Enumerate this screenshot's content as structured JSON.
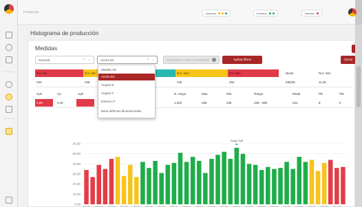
{
  "app": {
    "name": "Producción"
  },
  "rail_icons": [
    "logo-icon",
    "home-icon",
    "location-icon",
    "document-icon",
    "settings-icon",
    "gauge-icon",
    "stats-icon",
    "tag-icon",
    "menu-icon"
  ],
  "topbar": {
    "pills": [
      {
        "label": "Alarmas"
      },
      {
        "label": "Eventos"
      },
      {
        "label": "Nombre"
      }
    ]
  },
  "page": {
    "title": "Histograma de producción"
  },
  "card": {
    "title": "Medidas"
  },
  "filters": {
    "general_label": "General",
    "measure_label": "Ancho EC",
    "date_label": "22/04/2024 12:00 a 22/04/2024",
    "apply_label": "Aplicar filtros",
    "close_label": "Cerrar"
  },
  "dropdown": {
    "items": [
      {
        "label": "Medida AB",
        "selected": false
      },
      {
        "label": "Ancho EC",
        "selected": true
      },
      {
        "label": "Ángulo B",
        "selected": false
      },
      {
        "label": "Ángulo E",
        "selected": false
      },
      {
        "label": "Extremo F",
        "selected": false
      },
      {
        "label": "Baso defectos dimensionales",
        "selected": false
      }
    ]
  },
  "limits_table": {
    "headers": [
      {
        "label": "Tol. Min",
        "style": "red"
      },
      {
        "label": "Nor. Min",
        "style": "yellow"
      },
      {
        "label": "",
        "style": "teal"
      },
      {
        "label": "Nor. Max",
        "style": "yellow"
      },
      {
        "label": "Tol. Max",
        "style": "red"
      },
      {
        "label": "Nivan",
        "style": "plain"
      },
      {
        "label": "Nor. Nos",
        "style": "plain"
      }
    ],
    "values": [
      "230",
      "235",
      "245",
      "250",
      "235/25",
      "11,45"
    ]
  },
  "stats_table": {
    "headers": [
      "Cpk",
      "Cp",
      "Cpk",
      "N. rango",
      "Max.",
      "Min.",
      "Rango",
      "Moda",
      "PE",
      "PIK"
    ],
    "values": [
      "1,88",
      "0,44",
      "",
      "1,284",
      "258",
      "235",
      "235 - 258",
      "244",
      "8",
      "0"
    ]
  },
  "colors": {
    "red": "#e23d48",
    "yellow": "#f5c41f",
    "green": "#1fad4a",
    "accent": "#a82626"
  },
  "chart_data": {
    "type": "bar",
    "title": "",
    "xlabel": "",
    "ylabel": "",
    "ylim": [
      0,
      60
    ],
    "yticks": [
      "60,00",
      "50,00",
      "40,00",
      "30,00",
      "20,00",
      "10,00",
      "0,00"
    ],
    "target_label": "Target 245",
    "target_index": 24,
    "categories": [
      "231,00",
      "231,50",
      "232,00",
      "232,50",
      "233,00",
      "233,50",
      "234,00",
      "234,50",
      "235,00",
      "235,50",
      "236,00",
      "236,50",
      "237,00",
      "237,50",
      "238,00",
      "238,50",
      "239,00",
      "239,50",
      "240,00",
      "240,50",
      "241,00",
      "241,50",
      "242,00",
      "242,50",
      "243,00",
      "243,50",
      "244,00",
      "244,50",
      "245,00",
      "245,50",
      "246,00",
      "246,50",
      "247,00",
      "247,50",
      "248,00",
      "248,50",
      "249,00",
      "249,50",
      "250,00",
      "250,50",
      "251,00",
      "251,50"
    ],
    "values": [
      34,
      27,
      39,
      35,
      45,
      47,
      28,
      39,
      27,
      42,
      36,
      43,
      31,
      39,
      41,
      51,
      42,
      47,
      43,
      31,
      45,
      49,
      52,
      45,
      56,
      50,
      40,
      39,
      34,
      37,
      35,
      36,
      42,
      35,
      47,
      42,
      44,
      33,
      41,
      44,
      36,
      37
    ],
    "bar_colors": [
      "red",
      "red",
      "red",
      "red",
      "red",
      "yellow",
      "yellow",
      "yellow",
      "yellow",
      "green",
      "green",
      "green",
      "green",
      "green",
      "green",
      "green",
      "green",
      "green",
      "green",
      "green",
      "green",
      "green",
      "green",
      "green",
      "green",
      "green",
      "green",
      "green",
      "green",
      "green",
      "green",
      "green",
      "green",
      "green",
      "green",
      "green",
      "yellow",
      "yellow",
      "yellow",
      "red",
      "red",
      "red"
    ],
    "x_tick_labels": [
      "231,00",
      "232,00",
      "233,00",
      "234,00",
      "235,00",
      "236,00",
      "237,00",
      "238,00",
      "239,00",
      "240,00",
      "241,00",
      "242,00",
      "243,00",
      "244,00",
      "245,00",
      "246,00",
      "247,00",
      "248,00",
      "249,00",
      "250,00",
      "251,00"
    ]
  }
}
